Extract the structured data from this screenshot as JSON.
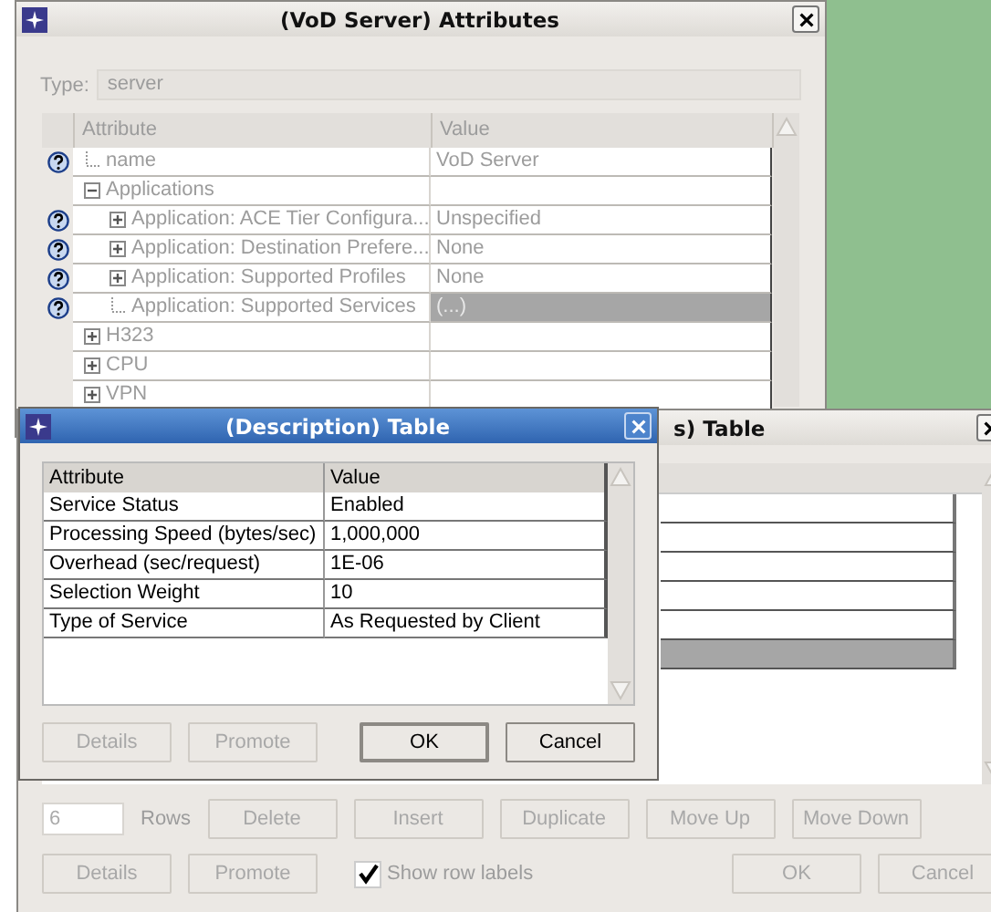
{
  "attributes_window": {
    "title": "(VoD Server) Attributes",
    "type_label": "Type:",
    "type_value": "server",
    "columns": [
      "Attribute",
      "Value"
    ],
    "rows": [
      {
        "name": "name",
        "value": "VoD Server",
        "help": true,
        "selected": false
      },
      {
        "name": "Applications",
        "value": "",
        "help": false,
        "selected": false,
        "expanded": true,
        "children": [
          {
            "name": "Application: ACE Tier Configura...",
            "value": "Unspecified",
            "help": true,
            "selected": false,
            "expanded": false
          },
          {
            "name": "Application: Destination Prefere...",
            "value": "None",
            "help": true,
            "selected": false,
            "expanded": false
          },
          {
            "name": "Application: Supported Profiles",
            "value": "None",
            "help": true,
            "selected": false,
            "expanded": false
          },
          {
            "name": "Application: Supported Services",
            "value": "(...)",
            "help": true,
            "selected": true
          }
        ]
      },
      {
        "name": "H323",
        "value": "",
        "help": false,
        "selected": false,
        "expanded": false
      },
      {
        "name": "CPU",
        "value": "",
        "help": false,
        "selected": false,
        "expanded": false
      },
      {
        "name": "VPN",
        "value": "",
        "help": false,
        "selected": false,
        "expanded": false
      }
    ]
  },
  "table_window": {
    "title": "s) Table",
    "rows": [
      {
        "selected": false
      },
      {
        "selected": false
      },
      {
        "selected": false
      },
      {
        "selected": false
      },
      {
        "selected": false
      },
      {
        "selected": true
      }
    ],
    "row_count": "6",
    "rows_label": "Rows",
    "row_buttons": [
      {
        "label": "Delete",
        "disabled": true
      },
      {
        "label": "Insert",
        "disabled": true
      },
      {
        "label": "Duplicate",
        "disabled": true
      },
      {
        "label": "Move Up",
        "disabled": true
      },
      {
        "label": "Move Down",
        "disabled": true
      }
    ],
    "buttons": [
      {
        "label": "Details",
        "disabled": true
      },
      {
        "label": "Promote",
        "disabled": true
      }
    ],
    "show_row_labels": {
      "label": "Show row labels",
      "checked": true
    },
    "dialog_buttons": [
      {
        "label": "OK",
        "disabled": true
      },
      {
        "label": "Cancel",
        "disabled": true
      }
    ]
  },
  "description_window": {
    "title": "(Description) Table",
    "columns": [
      "Attribute",
      "Value"
    ],
    "rows": [
      {
        "attribute": "Service Status",
        "value": "Enabled"
      },
      {
        "attribute": "Processing Speed (bytes/sec)",
        "value": "1,000,000"
      },
      {
        "attribute": "Overhead (sec/request)",
        "value": "1E-06"
      },
      {
        "attribute": "Selection Weight",
        "value": "10"
      },
      {
        "attribute": "Type of Service",
        "value": "As Requested by Client"
      }
    ],
    "buttons": [
      {
        "label": "Details",
        "disabled": true,
        "default": false
      },
      {
        "label": "Promote",
        "disabled": true,
        "default": false
      },
      {
        "label": "OK",
        "disabled": false,
        "default": true
      },
      {
        "label": "Cancel",
        "disabled": false,
        "default": false
      }
    ]
  }
}
